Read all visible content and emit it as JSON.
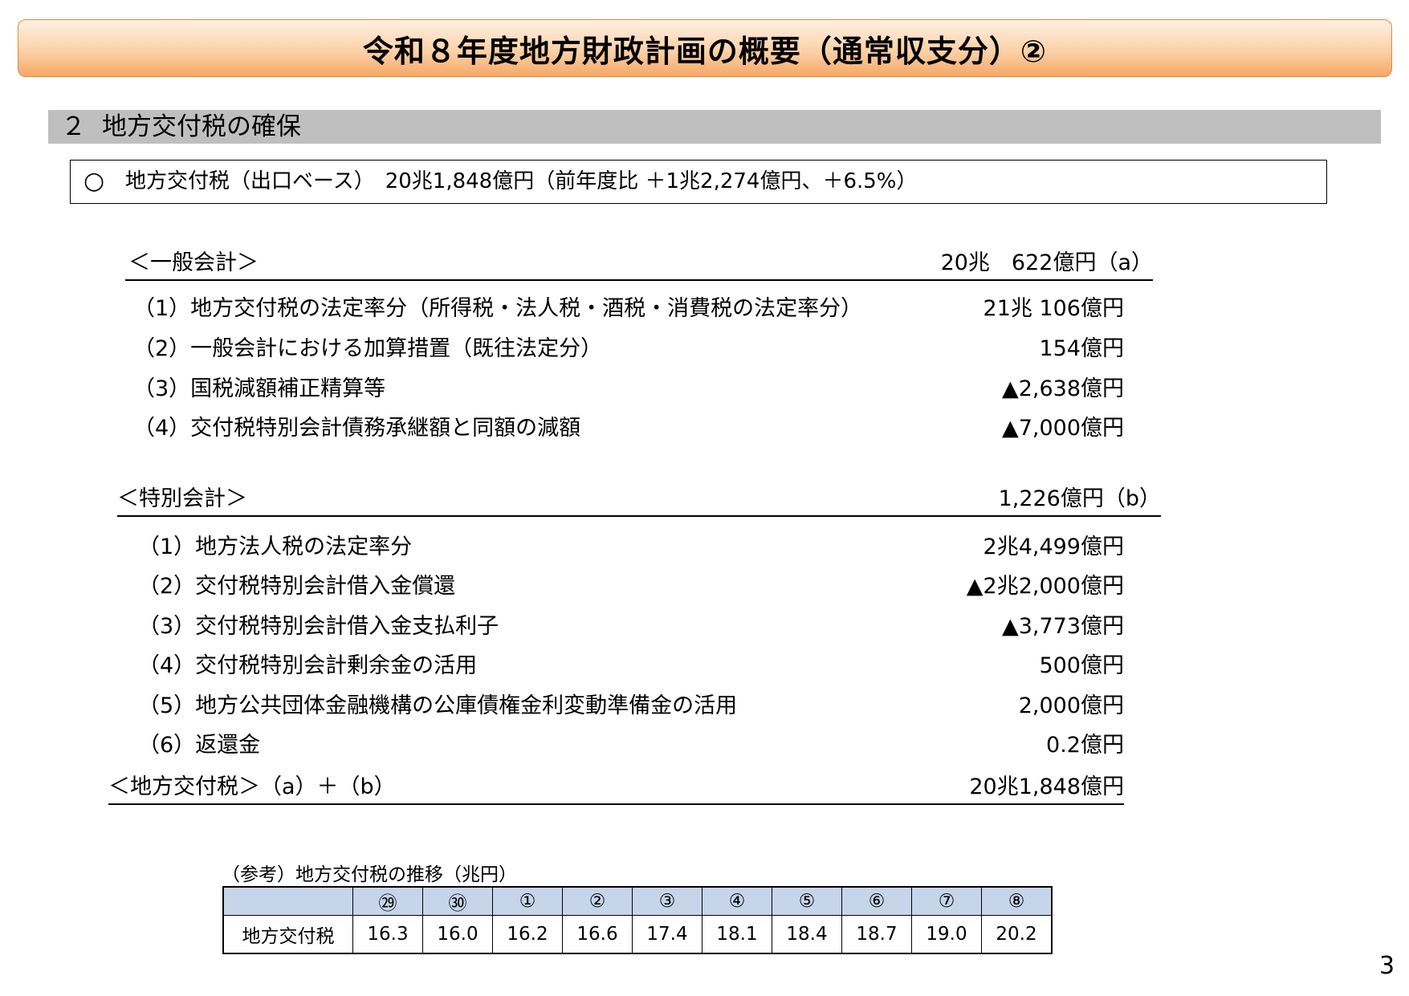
{
  "title": "令和８年度地方財政計画の概要（通常収支分）②",
  "section": {
    "number": "２",
    "title": "地方交付税の確保"
  },
  "summary": {
    "bullet": "○",
    "text": "地方交付税（出口ベース）　20兆1,848億円（前年度比 ＋1兆2,274億円、＋6.5%）"
  },
  "general_account": {
    "heading": "＜一般会計＞",
    "amount": "20兆　622億円（a）",
    "items": [
      {
        "label": "（1）地方交付税の法定率分（所得税・法人税・酒税・消費税の法定率分）",
        "amount": "21兆 106億円"
      },
      {
        "label": "（2）一般会計における加算措置（既往法定分）",
        "amount": "154億円"
      },
      {
        "label": "（3）国税減額補正精算等",
        "amount": "▲2,638億円"
      },
      {
        "label": "（4）交付税特別会計債務承継額と同額の減額",
        "amount": "▲7,000億円"
      }
    ]
  },
  "special_account": {
    "heading": "＜特別会計＞",
    "amount": "1,226億円（b）",
    "items": [
      {
        "label": "（1）地方法人税の法定率分",
        "amount": "2兆4,499億円"
      },
      {
        "label": "（2）交付税特別会計借入金償還",
        "amount": "▲2兆2,000億円"
      },
      {
        "label": "（3）交付税特別会計借入金支払利子",
        "amount": "▲3,773億円"
      },
      {
        "label": "（4）交付税特別会計剰余金の活用",
        "amount": "500億円"
      },
      {
        "label": "（5）地方公共団体金融機構の公庫債権金利変動準備金の活用",
        "amount": "2,000億円"
      },
      {
        "label": "（6）返還金",
        "amount": "0.2億円"
      }
    ]
  },
  "total": {
    "label": "＜地方交付税＞（a）＋（b）",
    "amount": "20兆1,848億円"
  },
  "reference": {
    "caption": "（参考）地方交付税の推移（兆円）",
    "row_label": "地方交付税",
    "years": [
      "㉙",
      "㉚",
      "①",
      "②",
      "③",
      "④",
      "⑤",
      "⑥",
      "⑦",
      "⑧"
    ],
    "values": [
      "16.3",
      "16.0",
      "16.2",
      "16.6",
      "17.4",
      "18.1",
      "18.4",
      "18.7",
      "19.0",
      "20.2"
    ]
  },
  "page_number": "3",
  "colors": {
    "title_gradient_top": "#fef0e2",
    "title_gradient_bottom": "#f6a865",
    "title_border": "#e08a3c",
    "section_bar": "#bfbfbf",
    "table_header": "#c6d5ea"
  }
}
